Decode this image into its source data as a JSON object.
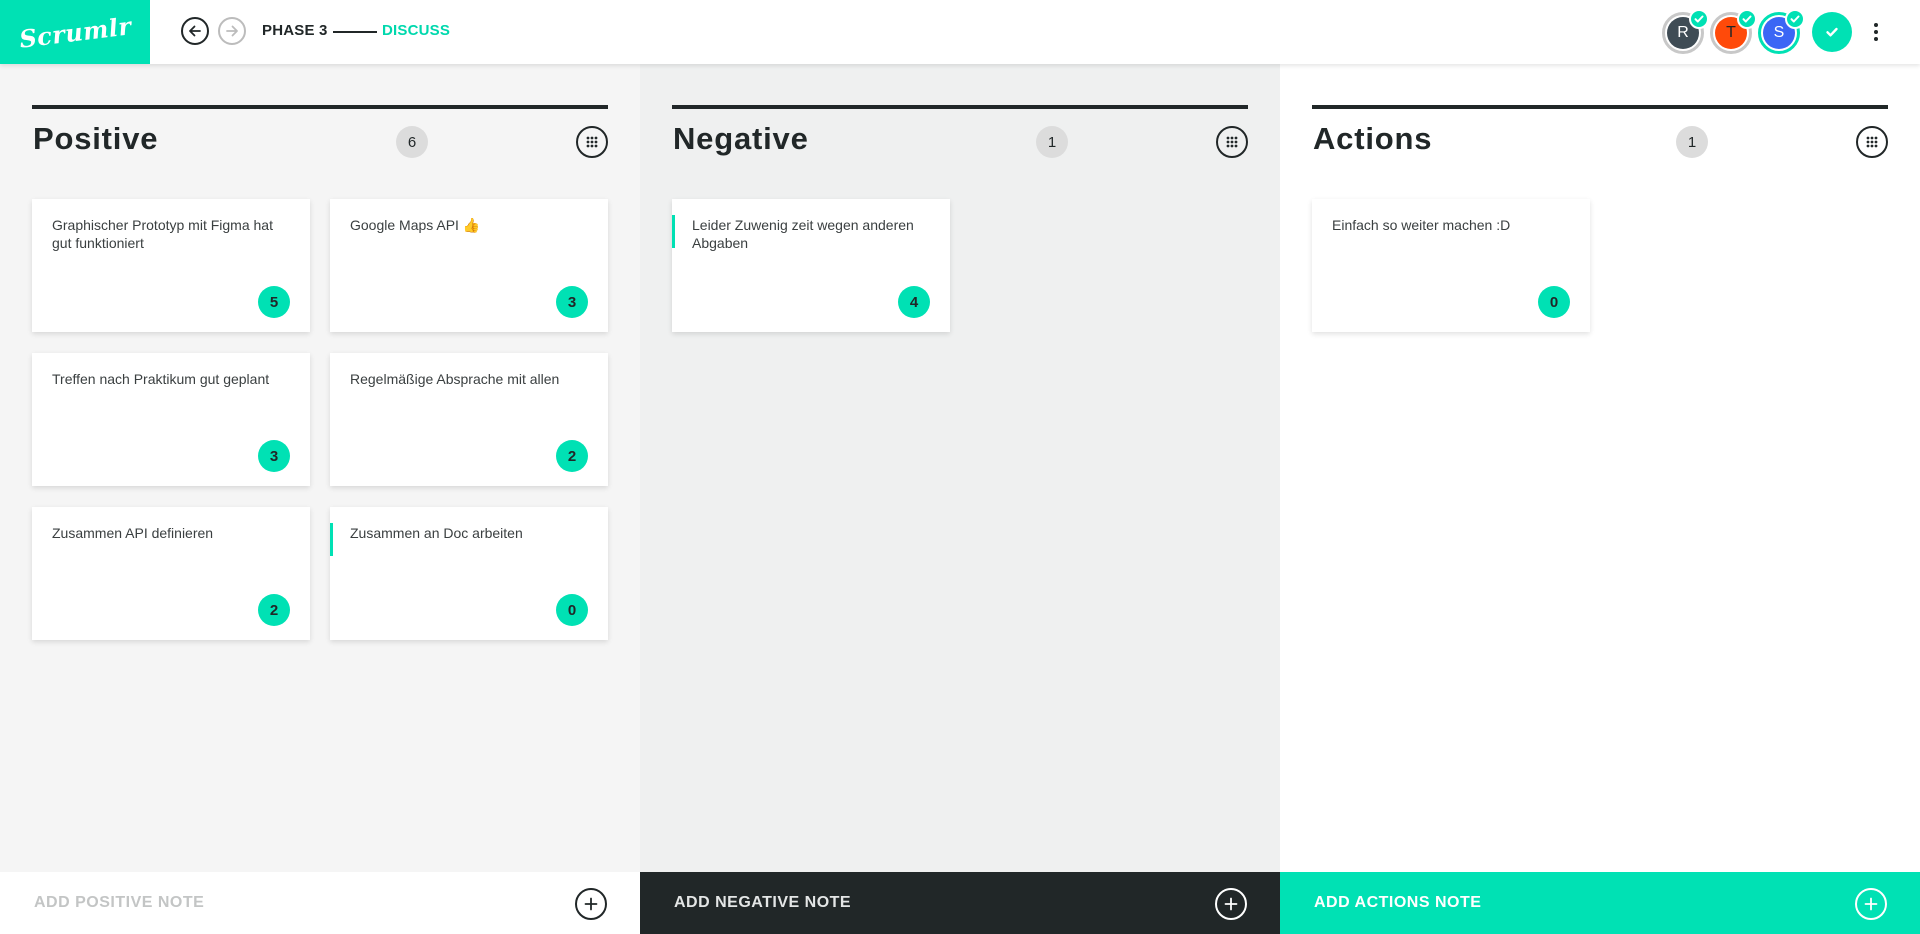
{
  "app": {
    "logo_text": "Scrumlr",
    "accent_color": "#00e1b4",
    "dark_color": "#212728"
  },
  "header": {
    "phase_label": "PHASE 3",
    "phase_name": "DISCUSS",
    "back_icon": "arrow-left-icon",
    "forward_icon": "arrow-right-icon",
    "participants": [
      {
        "initial": "R",
        "color": "#3f4c55",
        "ready": true
      },
      {
        "initial": "T",
        "color": "#ff4a0a",
        "ready": true
      },
      {
        "initial": "S",
        "color": "#3b66f5",
        "ready": true
      }
    ],
    "done_icon": "check-icon",
    "menu_icon": "more-vertical-icon"
  },
  "columns": [
    {
      "title": "Positive",
      "count": "6",
      "notes": [
        {
          "text": "Graphischer Prototyp mit Figma hat gut funktioniert",
          "votes": "5"
        },
        {
          "text": "Google Maps API 👍",
          "votes": "3"
        },
        {
          "text": "Treffen nach Praktikum gut geplant",
          "votes": "3"
        },
        {
          "text": "Regelmäßige Absprache mit allen",
          "votes": "2"
        },
        {
          "text": "Zusammen API definieren",
          "votes": "2"
        },
        {
          "text": "Zusammen an Doc arbeiten",
          "votes": "0",
          "focused": true
        }
      ],
      "add_label": "ADD POSITIVE NOTE"
    },
    {
      "title": "Negative",
      "count": "1",
      "notes": [
        {
          "text": "Leider Zuwenig zeit wegen anderen Abgaben",
          "votes": "4",
          "focused": true
        }
      ],
      "add_label": "ADD NEGATIVE NOTE"
    },
    {
      "title": "Actions",
      "count": "1",
      "notes": [
        {
          "text": "Einfach so weiter machen :D",
          "votes": "0"
        }
      ],
      "add_label": "ADD ACTIONS NOTE"
    }
  ]
}
